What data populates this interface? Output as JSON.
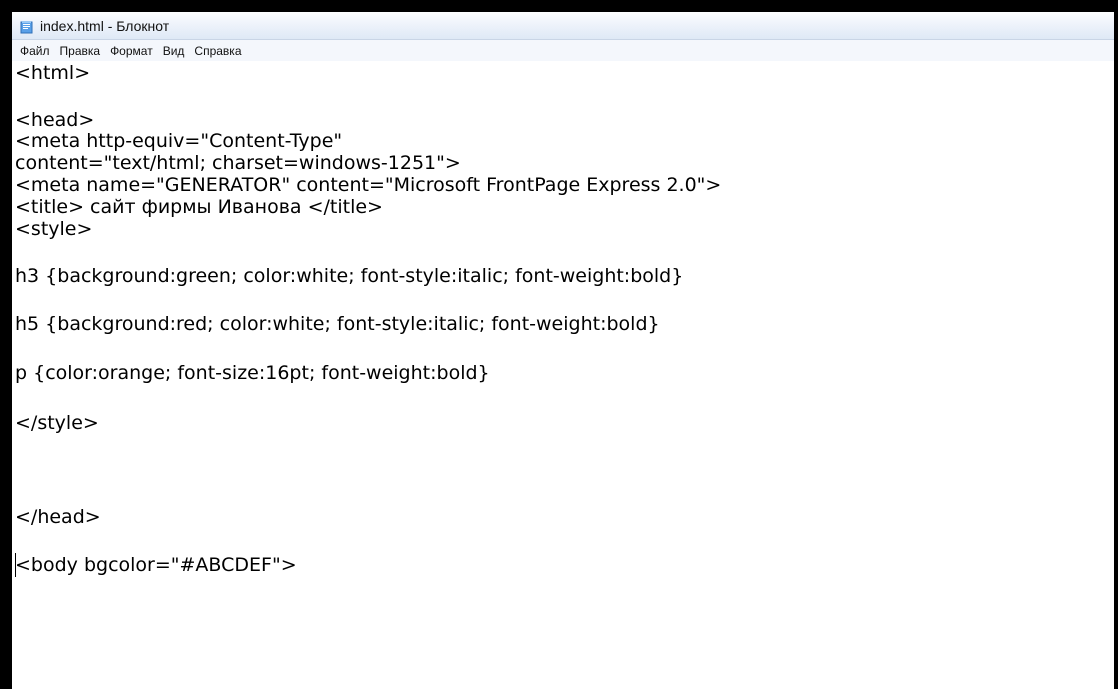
{
  "window": {
    "title": "index.html - Блокнот"
  },
  "menu": [
    {
      "label": "Файл"
    },
    {
      "label": "Правка"
    },
    {
      "label": "Формат"
    },
    {
      "label": "Вид"
    },
    {
      "label": "Справка"
    }
  ],
  "editor": {
    "lines": [
      "<html>",
      "<head>",
      "<meta http-equiv=\"Content-Type\"",
      "content=\"text/html; charset=windows-1251\">",
      "<meta name=\"GENERATOR\" content=\"Microsoft FrontPage Express 2.0\">",
      "<title> сайт фирмы Иванова </title>",
      "<style>",
      "h3 {background:green; color:white; font-style:italic; font-weight:bold}",
      "h5 {background:red; color:white; font-style:italic; font-weight:bold}",
      "p {color:orange; font-size:16pt; font-weight:bold}",
      "</style>",
      "</head>",
      "<body bgcolor=\"#ABCDEF\">"
    ]
  },
  "colors": {
    "frame": "#000000",
    "titlebar": "#eef3fb",
    "menubar": "#f4f7fc",
    "editor_bg": "#ffffff",
    "text": "#000000"
  },
  "icons": {
    "app": "notepad-icon"
  }
}
